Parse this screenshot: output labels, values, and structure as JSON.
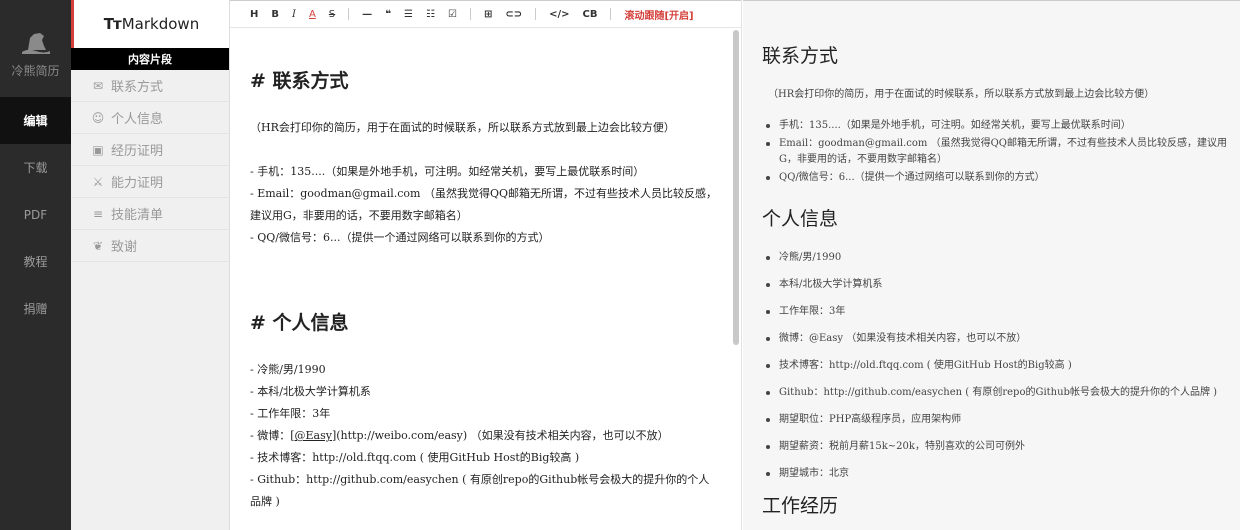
{
  "app": {
    "name": "冷熊简历"
  },
  "nav": {
    "items": [
      {
        "label": "编辑",
        "active": true
      },
      {
        "label": "下载",
        "active": false
      },
      {
        "label": "PDF",
        "active": false
      },
      {
        "label": "教程",
        "active": false
      },
      {
        "label": "捐赠",
        "active": false
      }
    ]
  },
  "sidebar": {
    "brand_prefix": "Tт",
    "brand_text": "Markdown",
    "section_title": "内容片段",
    "items": [
      {
        "label": "联系方式",
        "icon": "envelope-icon",
        "glyph": "✉"
      },
      {
        "label": "个人信息",
        "icon": "smile-icon",
        "glyph": "☺"
      },
      {
        "label": "经历证明",
        "icon": "briefcase-icon",
        "glyph": "▣"
      },
      {
        "label": "能力证明",
        "icon": "badge-icon",
        "glyph": "⚔"
      },
      {
        "label": "技能清单",
        "icon": "list-icon",
        "glyph": "≡"
      },
      {
        "label": "致谢",
        "icon": "heart-hands-icon",
        "glyph": "❦"
      }
    ]
  },
  "toolbar": {
    "buttons": [
      "H",
      "B",
      "I",
      "A",
      "S",
      "—",
      "❝",
      "☰",
      "☷",
      "☑",
      "⊞",
      "⊂⊃",
      "</>",
      "CB"
    ],
    "scroll_sync": "滚动跟随[开启]"
  },
  "editor": {
    "h1_contact": "# 联系方式",
    "contact_note": "（HR会打印你的简历，用于在面试的时候联系，所以联系方式放到最上边会比较方便）",
    "contact_lines": [
      "- 手机：135....（如果是外地手机，可注明。如经常关机，要写上最优联系时间）",
      "- Email：goodman@gmail.com （虽然我觉得QQ邮箱无所谓，不过有些技术人员比较反感，建议用G，非要用的话，不要用数字邮箱名）",
      "- QQ/微信号：6...（提供一个通过网络可以联系到你的方式）"
    ],
    "h1_info": "# 个人信息",
    "info_lines": [
      "- 冷熊/男/1990",
      "- 本科/北极大学计算机系",
      "- 工作年限：3年"
    ],
    "weibo_prefix": "- 微博：[",
    "weibo_link": "@Easy",
    "weibo_suffix": "](http://weibo.com/easy) （如果没有技术相关内容，也可以不放）",
    "info_lines_2": [
      "- 技术博客：http://old.ftqq.com ( 使用GitHub Host的Big较高 )",
      "- Github：http://github.com/easychen ( 有原创repo的Github帐号会极大的提升你的个人品牌 )"
    ]
  },
  "preview": {
    "h2_contact": "联系方式",
    "contact_note": "（HR会打印你的简历，用于在面试的时候联系，所以联系方式放到最上边会比较方便）",
    "contact_items": [
      "手机：135....（如果是外地手机，可注明。如经常关机，要写上最优联系时间）",
      "Email：goodman@gmail.com （虽然我觉得QQ邮箱无所谓，不过有些技术人员比较反感，建议用G，非要用的话，不要用数字邮箱名）",
      "QQ/微信号：6...（提供一个通过网络可以联系到你的方式）"
    ],
    "h2_info": "个人信息",
    "info_items": [
      "冷熊/男/1990",
      "本科/北极大学计算机系",
      "工作年限：3年",
      "微博：@Easy （如果没有技术相关内容，也可以不放）",
      "技术博客：http://old.ftqq.com ( 使用GitHub Host的Big较高 )",
      "Github：http://github.com/easychen ( 有原创repo的Github帐号会极大的提升你的个人品牌 )",
      "期望职位：PHP高级程序员，应用架构师",
      "期望薪资：税前月薪15k~20k，特别喜欢的公司可例外",
      "期望城市：北京"
    ],
    "h2_work": "工作经历"
  }
}
